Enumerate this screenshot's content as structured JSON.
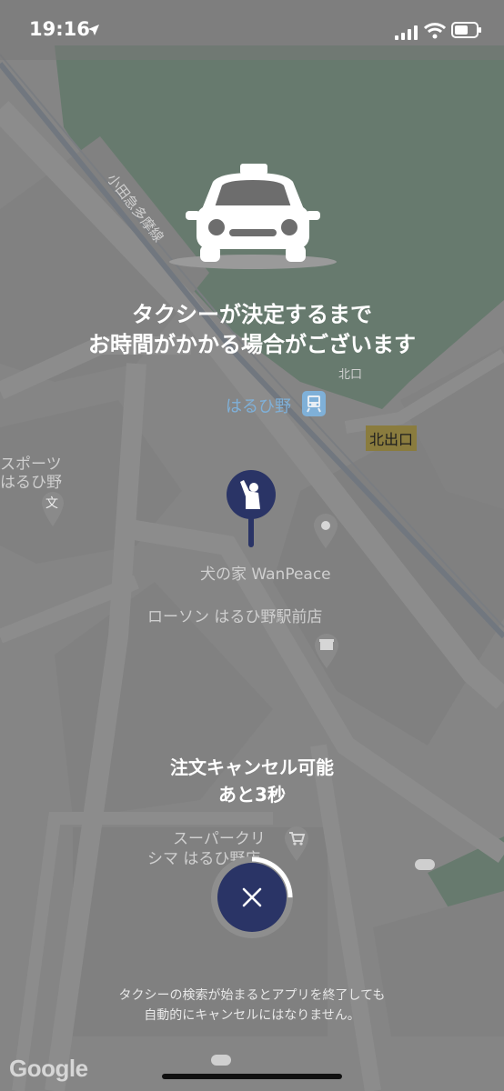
{
  "status_bar": {
    "time": "19:16"
  },
  "map": {
    "labels": {
      "railway": "小田急多摩線",
      "north_exit_small": "北口",
      "station": "はるひ野",
      "north_exit": "北出口",
      "sports_line1": "スポーツ",
      "sports_line2": "はるひ野",
      "school_glyph": "文",
      "pet_shop": "犬の家 WanPeace",
      "lawson": "ローソン はるひ野駅前店",
      "supermarket_line1": "スーパークリ",
      "supermarket_line2": "シマ はるひ野店"
    },
    "attribution": "Google"
  },
  "headline": {
    "line1": "タクシーが決定するまで",
    "line2": "お時間がかかる場合がございます"
  },
  "cancel": {
    "line1": "注文キャンセル可能",
    "line2": "あと3秒",
    "button_icon": "close-icon",
    "progress": 0.25
  },
  "note": {
    "line1": "タクシーの検索が始まるとアプリを終了しても",
    "line2": "自動的にキャンセルにはなりません。"
  },
  "colors": {
    "accent": "#2a3466",
    "park": "#8fc2a0"
  }
}
